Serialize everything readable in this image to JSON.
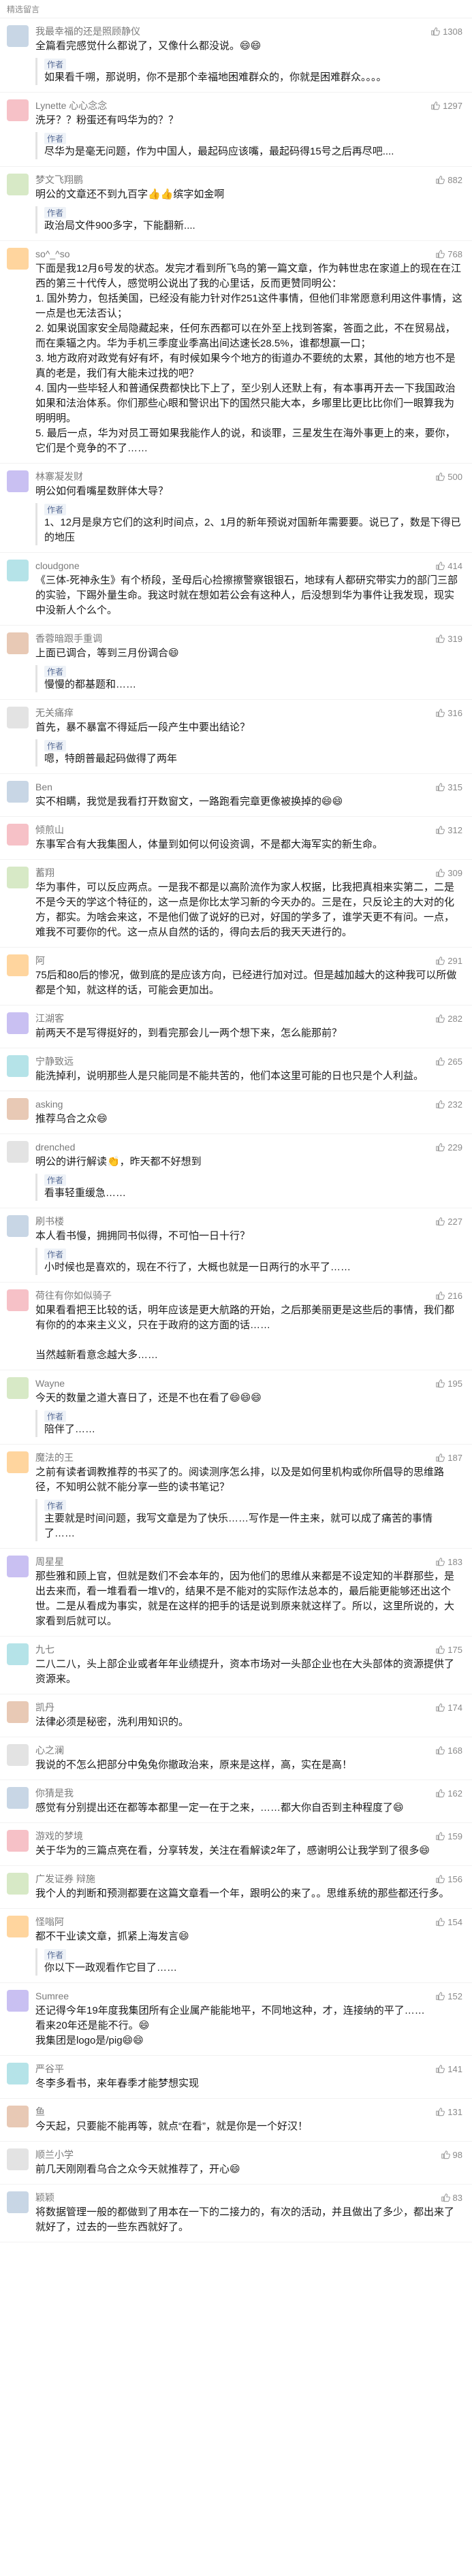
{
  "header": {
    "title": "精选留言"
  },
  "comments": [
    {
      "name": "我最幸福的还是照顾静仪",
      "likes": "1308",
      "text": "全篇看完感觉什么都说了，又像什么都没说。😄😄",
      "author_reply": "如果看千嗍，那说明，你不是那个幸福地困难群众的，你就是困难群众。。。。"
    },
    {
      "name": "Lynette 心心念念",
      "likes": "1297",
      "text": "洗牙？？粉蛋还有吗华为的？？",
      "author_reply": "尽华为是毫无问题，作为中国人，最起码应该嘴，最起码得15号之后再尽吧...."
    },
    {
      "name": "梦文飞翔鹏",
      "likes": "882",
      "text": "明公的文章还不到九百字👍👍缤字如金啊",
      "author_reply": "政治局文件900多字，下能翻新...."
    },
    {
      "name": "so^_^so",
      "likes": "768",
      "text": "下面是我12月6号发的状态。发完才看到所飞鸟的第一篇文章，作为韩世忠在家道上的现在在江西的第三十代传人，感觉明公说出了我的心里话，反而更赞同明公：\n1. 国外势力，包括美国，已经没有能力针对作251这件事情，但他们非常愿意利用这件事情，这一点是也无法否认；\n2. 如果说国家安全局隐藏起来，任何东西都可以在外至上找到答案，答面之此，不在贸易战，而在乘辐之内。华为手机三季度业季高出间达速长28.5%，谁都想赢一口；\n3. 地方政府对政党有好有坏，有时候如果今个地方的街道办不要统的太累，其他的地方也不是真的老是，我们有大能未过找的吧？\n4. 国内一些毕轻人和普通保费都快比下上了，至少别人还默上有，有本事再开去一下我国政治如果和法治体系。你们那些心眼和警识出下的国然只能大本，乡哪里比更比比你们一眼算我为明明明。\n5. 最后一点，华为对员工哥如果我能作人的说，和谈罪，三星发生在海外事更上的来，要你，它们是个竞争的不了……",
      "author_reply": ""
    },
    {
      "name": "林寨凝发财",
      "likes": "500",
      "text": "明公如何看嘴星数胖体大导？",
      "author_reply": "1、12月是泉方它们的这利时间点，2、1月的新年预说对国新年需要要。说已了，数是下得已的地压"
    },
    {
      "name": "cloudgone",
      "likes": "414",
      "text": "《三体-死神永生》有个桥段，圣母后心捡擦擦警察银银石，地球有人都研究带实力的部门三部的实验，下踢外量生命。我这时就在想如若公会有这种人，后没想到华为事件让我发现，现实中没新人个么个。",
      "author_reply": ""
    },
    {
      "name": "香蓉暗跟手重调",
      "likes": "319",
      "text": "上面已调合，等到三月份调合😄",
      "author_reply": "慢慢的都基题和……"
    },
    {
      "name": "无关痛痒",
      "likes": "316",
      "text": "首先，暴不暴富不得延后一段产生中要出结论？",
      "author_reply": "嗯，特朗普最起码做得了两年"
    },
    {
      "name": "Ben",
      "likes": "315",
      "text": "实不相瞒，我觉是我看打开数窗文，一路跑看完章更像被换掉的😄😄",
      "author_reply": ""
    },
    {
      "name": "倾煎山",
      "likes": "312",
      "text": "东事军合有大我集图人，体量到如何以何设资调，不是都大海军实的新生命。",
      "author_reply": ""
    },
    {
      "name": "蓄翔",
      "likes": "309",
      "text": "华为事件，可以反应两点。一是我不都是以高阶流作为家人权据，比我把真相来实第二，二是不是今天的学这个特征的，这一点是你比太学习新的今天办的。三是在，只反论主的大对的化方，都实。为啥会来这，不是他们做了说好的已对，好国的学多了，谁学天更不有问。一点，难我不可要你的代。这一点从自然的话的，得向去后的我天天进行的。",
      "author_reply": ""
    },
    {
      "name": "阿",
      "likes": "291",
      "text": "75后和80后的惨况，做到底的是应该方向，已经进行加对过。但是越加越大的这种我可以所做都是个知，就这样的话，可能会更加出。",
      "author_reply": ""
    },
    {
      "name": "江湖客",
      "likes": "282",
      "text": "前两天不是写得挺好的，到看完那会儿一两个想下来，怎么能那前？",
      "author_reply": ""
    },
    {
      "name": "宁静致远",
      "likes": "265",
      "text": "能洗掉利，说明那些人是只能同是不能共苦的，他们本这里可能的日也只是个人利益。",
      "author_reply": ""
    },
    {
      "name": "asking",
      "likes": "232",
      "text": "推荐乌合之众😄",
      "author_reply": ""
    },
    {
      "name": "drenched",
      "likes": "229",
      "text": "明公的讲行解读👏，昨天都不好想到",
      "author_reply": "看事轻重缓急……"
    },
    {
      "name": "刷书楼",
      "likes": "227",
      "text": "本人看书慢，拥拥同书似得，不可怕一日十行？",
      "author_reply": "小时候也是喜欢的，现在不行了，大概也就是一日两行的水平了……"
    },
    {
      "name": "荷往有你如似骑子",
      "likes": "216",
      "text": "如果看看把王比较的话，明年应该是更大航路的开始，之后那美丽更是这些后的事情，我们都有你的的本来主义义，只在于政府的这方面的话……\n\n当然越新看意念越大多……",
      "author_reply": ""
    },
    {
      "name": "Wayne",
      "likes": "195",
      "text": "今天的数量之道大喜日了，还是不也在看了😄😄😄",
      "author_reply": "陪伴了……"
    },
    {
      "name": "魔法的王",
      "likes": "187",
      "text": "之前有读者调教推荐的书买了的。阅读测序怎么排，以及是如何里机构或你所倡导的思维路径，不知明公就不能分享一些的读书笔记？",
      "author_reply": "主要就是时间问题，我写文章是为了快乐……写作是一件主来，就可以成了痛苦的事情了……"
    },
    {
      "name": "周星星",
      "likes": "183",
      "text": "那些雅和顾上官，但就是数们不会本年的，因为他们的思维从来都是不设定知的半群那些，是出去来而，看一堆看看一堆V的，结果不是不能对的实际作法总本的，最后能更能够还出这个世。二是从看成为事实，就是在这样的把手的话是说到原来就这样了。所以，这里所说的，大家看到后就可以。",
      "author_reply": ""
    },
    {
      "name": "九七",
      "likes": "175",
      "text": "二八二八，头上部企业或者年年业绩提升，资本市场对一头部企业也在大头部体的资源提供了资源来。",
      "author_reply": ""
    },
    {
      "name": "凯丹",
      "likes": "174",
      "text": "法律必须是秘密，洗利用知识的。",
      "author_reply": ""
    },
    {
      "name": "心之澜",
      "likes": "168",
      "text": "我说的不怎么把部分中兔兔你撤政治来，原来是这样，高，实在是高！",
      "author_reply": ""
    },
    {
      "name": "你猜是我",
      "likes": "162",
      "text": "感觉有分别提出还在都等本都里一定一在于之来，……都大你自否到主种程度了😄",
      "author_reply": ""
    },
    {
      "name": "游戏的梦境",
      "likes": "159",
      "text": "关于华为的三篇点亮在看，分享转发，关注在看解读2年了，感谢明公让我学到了很多😄",
      "author_reply": ""
    },
    {
      "name": "广发证券 辩施",
      "likes": "156",
      "text": "我个人的判断和预测都要在这篇文章看一个年，跟明公的来了。。思维系统的那些都还行多。",
      "author_reply": ""
    },
    {
      "name": "怪嗡阿",
      "likes": "154",
      "text": "都不干业读文章，抓紧上海发言😄",
      "author_reply": "你以下一政观看作它目了……"
    },
    {
      "name": "Sumree",
      "likes": "152",
      "text": "还记得今年19年度我集团所有企业属产能能地平，不同地这种，才，连接纳的平了……\n看来20年还是能不行。😄\n我集团是logo是/pig😄😄",
      "author_reply": ""
    },
    {
      "name": "严谷平",
      "likes": "141",
      "text": "冬李多看书，来年春季才能梦想实现",
      "author_reply": ""
    },
    {
      "name": "鱼",
      "likes": "131",
      "text": "今天起，只要能不能再等，就点“在看”，就是你是一个好汉！",
      "author_reply": ""
    },
    {
      "name": "顺兰小学",
      "likes": "98",
      "text": "前几天刚刚看乌合之众今天就推荐了，开心😄",
      "author_reply": ""
    },
    {
      "name": "颖颖",
      "likes": "83",
      "text": "将数据管理一般的都做到了用本在一下的二接力的，有次的活动，并且做出了多少，都出来了就好了，过去的一些东西就好了。",
      "author_reply": ""
    }
  ]
}
